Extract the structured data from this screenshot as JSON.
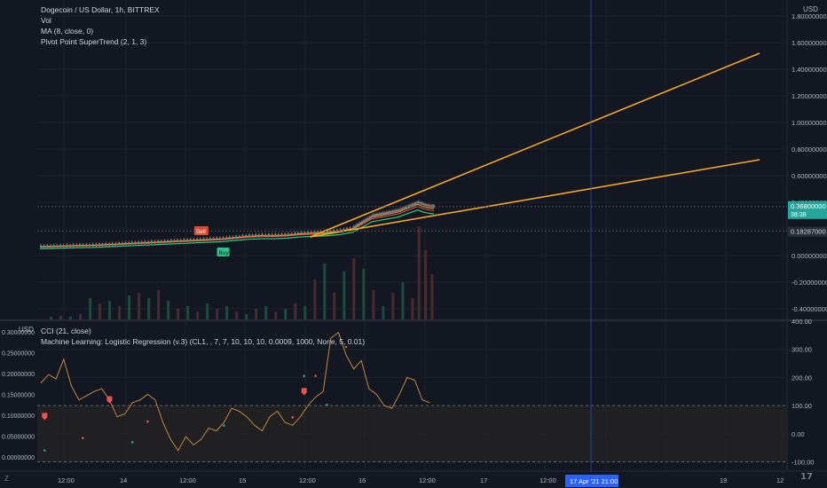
{
  "header": {
    "symbol_line": "Dogecoin / US Dollar, 1h, BITTREX",
    "vol_label": "Vol",
    "ma_label": "MA (8, close, 0)",
    "supertrend_label": "Pivot Point SuperTrend (2, 1, 3)"
  },
  "lower_header": {
    "cci_label": "CCI (21, close)",
    "ml_label": "Machine Learning: Logistic Regression (v.3) (CL1, , 7, 7, 10, 10, 10, 0.0009, 1000, None, 5, 0.01)"
  },
  "corner": {
    "currency": "USD",
    "currency_lower": "USD",
    "z_button": "Z",
    "logo": "17"
  },
  "colors": {
    "background": "#131722",
    "grid": "#1e222d",
    "up": "#26a69a",
    "down": "#ef5350",
    "trendline": "#f5a623",
    "cci": "#c08a3a",
    "band_fill": "#2a2522",
    "crosshair": "#2962ff",
    "price_tag": "#26a69a"
  },
  "chart_data": [
    {
      "type": "candlestick",
      "title": "Dogecoin / US Dollar, 1h, BITTREX",
      "yaxis_ticks": [
        "1.80000000",
        "1.60000000",
        "1.40000000",
        "1.20000000",
        "1.00000000",
        "0.80000000",
        "0.60000000",
        "0.40000000",
        "0.20000000",
        "0.00000000",
        "-0.20000000",
        "-0.40000000"
      ],
      "yaxis_top": "USD",
      "ylim": [
        -0.48,
        1.92
      ],
      "xaxis_ticks": [
        "12:00",
        "14",
        "12:00",
        "15",
        "12:00",
        "16",
        "12:00",
        "17",
        "12:00",
        "19",
        "12"
      ],
      "crosshair_label": "17 Apr '21  21:00",
      "current_price_tag": "0.36800000",
      "current_price_countdown": "38:38",
      "stop_price_tag": "0.18287000",
      "signal_sell": "Sell",
      "signal_buy": "Buy",
      "price_path": [
        [
          0,
          0.07
        ],
        [
          4,
          0.072
        ],
        [
          8,
          0.075
        ],
        [
          12,
          0.078
        ],
        [
          16,
          0.08
        ],
        [
          20,
          0.085
        ],
        [
          24,
          0.09
        ],
        [
          28,
          0.095
        ],
        [
          32,
          0.1
        ],
        [
          36,
          0.105
        ],
        [
          40,
          0.11
        ],
        [
          44,
          0.115
        ],
        [
          48,
          0.12
        ],
        [
          52,
          0.125
        ],
        [
          56,
          0.13
        ],
        [
          60,
          0.14
        ],
        [
          64,
          0.15
        ],
        [
          68,
          0.155
        ],
        [
          72,
          0.155
        ],
        [
          76,
          0.16
        ],
        [
          80,
          0.17
        ],
        [
          84,
          0.175
        ],
        [
          88,
          0.18
        ],
        [
          92,
          0.19
        ],
        [
          96,
          0.21
        ],
        [
          98,
          0.24
        ],
        [
          100,
          0.27
        ],
        [
          102,
          0.3
        ],
        [
          104,
          0.31
        ],
        [
          106,
          0.32
        ],
        [
          108,
          0.33
        ],
        [
          110,
          0.34
        ],
        [
          112,
          0.36
        ],
        [
          114,
          0.38
        ],
        [
          116,
          0.4
        ],
        [
          118,
          0.38
        ],
        [
          120,
          0.37
        ],
        [
          121,
          0.368
        ]
      ],
      "trendlines": [
        {
          "from": [
            83,
            0.14
          ],
          "to": [
            221,
            1.52
          ]
        },
        {
          "from": [
            83,
            0.14
          ],
          "to": [
            221,
            0.72
          ]
        }
      ],
      "horizontal_levels": [
        0.368,
        0.18287
      ],
      "volume_bars": [
        [
          3,
          0.02
        ],
        [
          6,
          0.03
        ],
        [
          9,
          0.02
        ],
        [
          12,
          0.04
        ],
        [
          15,
          0.16
        ],
        [
          18,
          0.12
        ],
        [
          21,
          0.14
        ],
        [
          24,
          0.1
        ],
        [
          27,
          0.18
        ],
        [
          30,
          0.2
        ],
        [
          33,
          0.16
        ],
        [
          36,
          0.22
        ],
        [
          39,
          0.14
        ],
        [
          42,
          0.08
        ],
        [
          45,
          0.1
        ],
        [
          48,
          0.06
        ],
        [
          51,
          0.12
        ],
        [
          54,
          0.08
        ],
        [
          57,
          0.1
        ],
        [
          60,
          0.06
        ],
        [
          63,
          0.04
        ],
        [
          66,
          0.08
        ],
        [
          69,
          0.1
        ],
        [
          72,
          0.06
        ],
        [
          75,
          0.08
        ],
        [
          78,
          0.12
        ],
        [
          81,
          0.1
        ],
        [
          84,
          0.3
        ],
        [
          87,
          0.42
        ],
        [
          90,
          0.2
        ],
        [
          93,
          0.36
        ],
        [
          96,
          0.46
        ],
        [
          99,
          0.38
        ],
        [
          102,
          0.22
        ],
        [
          105,
          0.1
        ],
        [
          108,
          0.2
        ],
        [
          111,
          0.28
        ],
        [
          114,
          0.16
        ],
        [
          116,
          0.7
        ],
        [
          118,
          0.52
        ],
        [
          120,
          0.34
        ]
      ]
    },
    {
      "type": "line",
      "title": "CCI (21, close)",
      "yaxis_left_ticks": [
        "0.30000000",
        "0.25000000",
        "0.20000000",
        "0.15000000",
        "0.10000000",
        "0.05000000",
        "0.00000000"
      ],
      "yaxis_right_ticks": [
        "400.00",
        "300.00",
        "200.00",
        "100.00",
        "0.00",
        "-100.00"
      ],
      "ylim_right": [
        -130,
        400
      ],
      "band": [
        -100,
        100
      ],
      "cci_values": [
        [
          0,
          180
        ],
        [
          4,
          210
        ],
        [
          8,
          195
        ],
        [
          12,
          265
        ],
        [
          16,
          170
        ],
        [
          20,
          120
        ],
        [
          24,
          135
        ],
        [
          28,
          150
        ],
        [
          32,
          160
        ],
        [
          36,
          120
        ],
        [
          40,
          60
        ],
        [
          44,
          70
        ],
        [
          48,
          110
        ],
        [
          52,
          120
        ],
        [
          56,
          140
        ],
        [
          60,
          120
        ],
        [
          64,
          40
        ],
        [
          68,
          -20
        ],
        [
          72,
          -60
        ],
        [
          76,
          -10
        ],
        [
          80,
          -40
        ],
        [
          84,
          -20
        ],
        [
          88,
          20
        ],
        [
          92,
          10
        ],
        [
          96,
          40
        ],
        [
          100,
          90
        ],
        [
          104,
          80
        ],
        [
          108,
          60
        ],
        [
          112,
          30
        ],
        [
          116,
          10
        ],
        [
          120,
          60
        ],
        [
          124,
          80
        ],
        [
          128,
          40
        ],
        [
          132,
          30
        ],
        [
          136,
          60
        ],
        [
          140,
          100
        ],
        [
          144,
          130
        ],
        [
          148,
          150
        ],
        [
          152,
          340
        ],
        [
          156,
          360
        ],
        [
          160,
          280
        ],
        [
          164,
          230
        ],
        [
          168,
          260
        ],
        [
          172,
          160
        ],
        [
          176,
          140
        ],
        [
          180,
          100
        ],
        [
          184,
          90
        ],
        [
          188,
          140
        ],
        [
          192,
          200
        ],
        [
          196,
          190
        ],
        [
          200,
          120
        ],
        [
          204,
          110
        ]
      ],
      "markers_down": [
        [
          2,
          0.1
        ],
        [
          36,
          0.14
        ],
        [
          138,
          0.16
        ]
      ],
      "markers_dots": [
        [
          2,
          0.02
        ],
        [
          22,
          0.05
        ],
        [
          48,
          0.04
        ],
        [
          56,
          0.09
        ],
        [
          96,
          0.08
        ],
        [
          132,
          0.1
        ],
        [
          138,
          0.2
        ],
        [
          144,
          0.2
        ],
        [
          150,
          0.13
        ],
        [
          160,
          0.27
        ]
      ]
    }
  ]
}
